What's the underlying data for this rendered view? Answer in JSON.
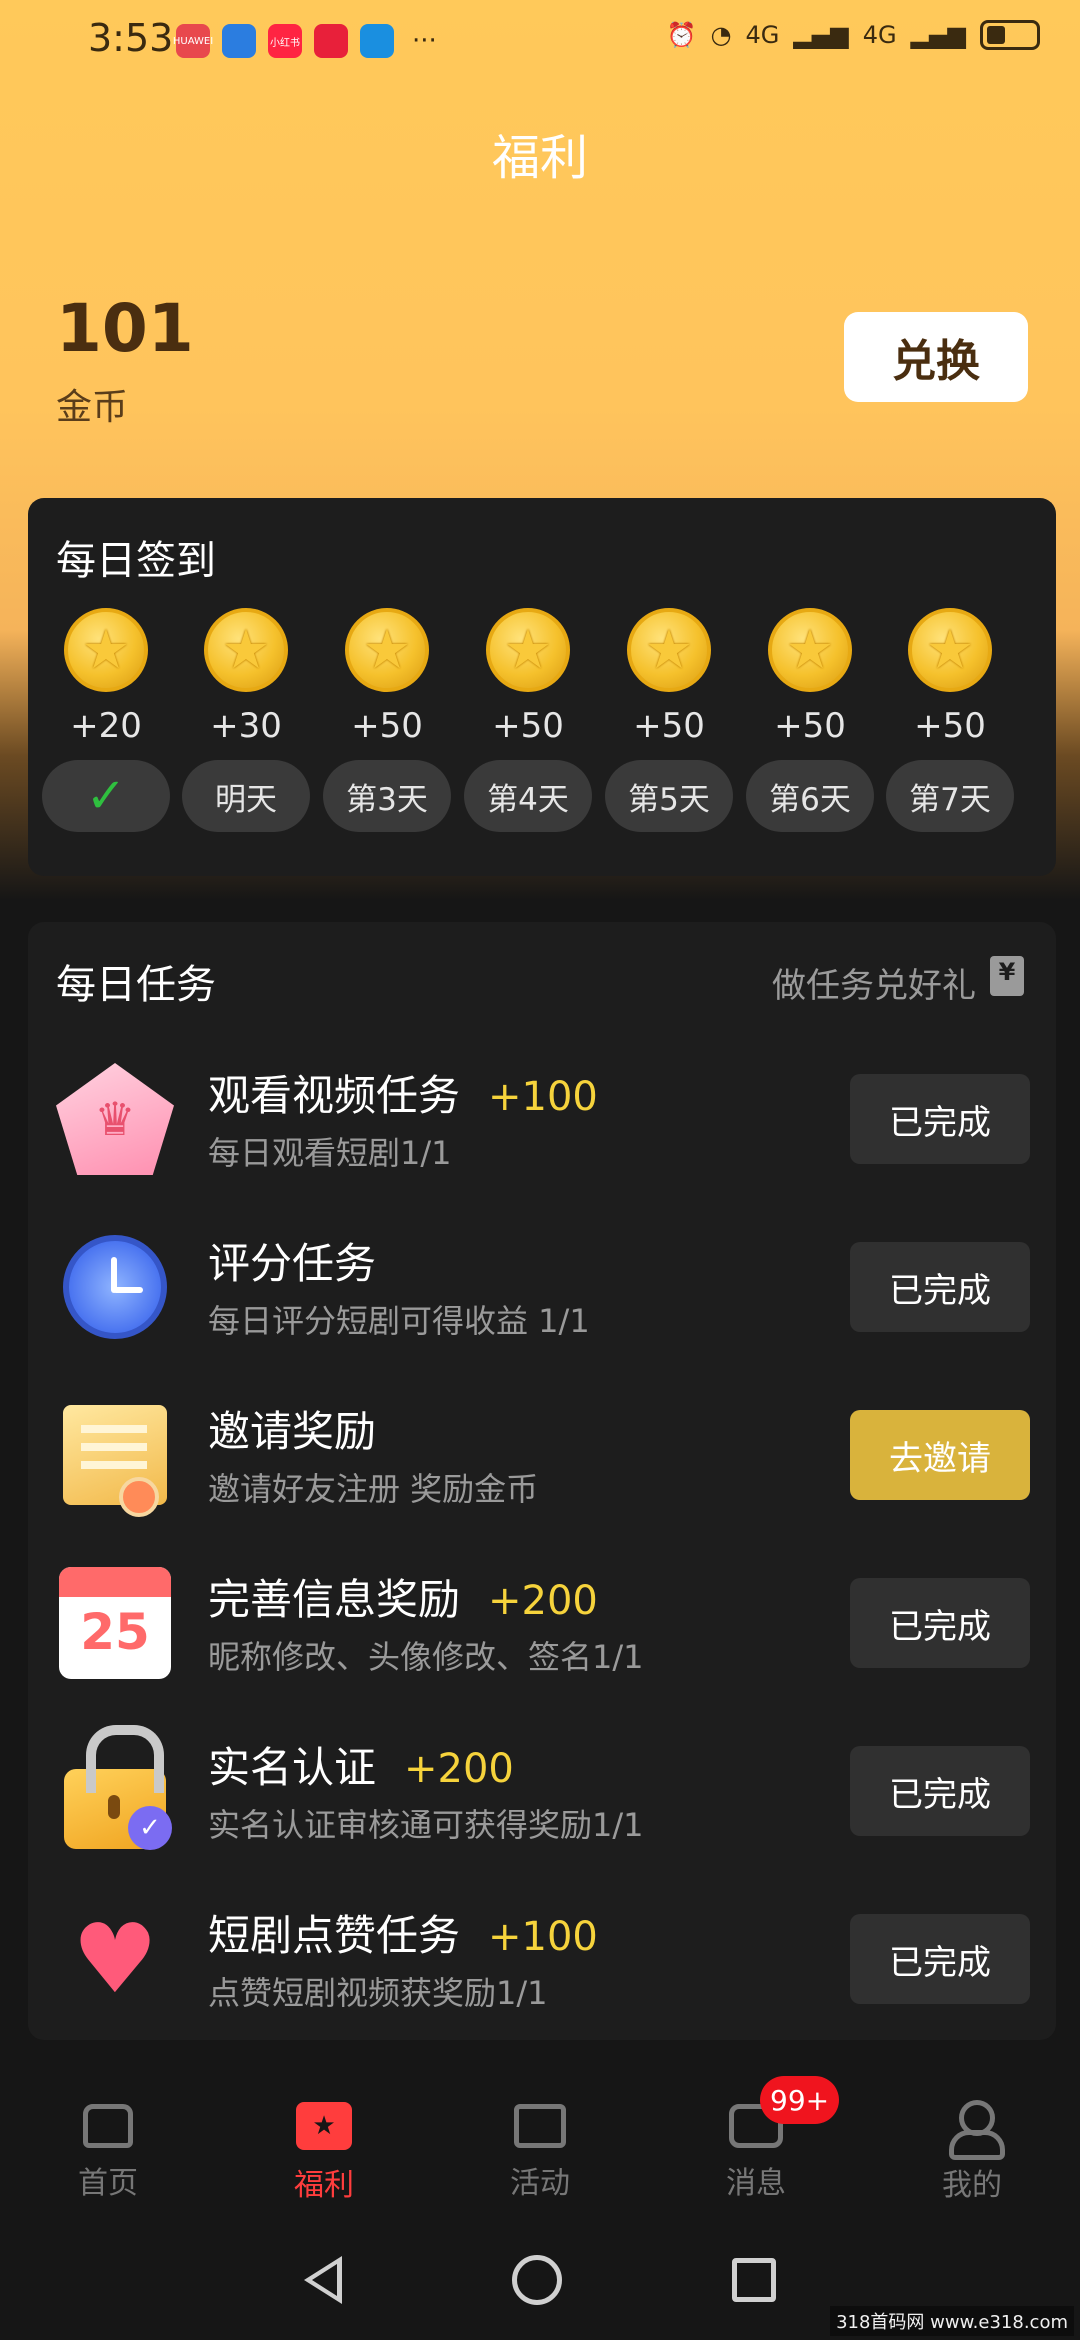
{
  "status_bar": {
    "time": "3:53",
    "apps": [
      {
        "label": "HUAWEI",
        "color": "#e8484d"
      },
      {
        "label": "",
        "color": "#2b7de0"
      },
      {
        "label": "小红书",
        "color": "#ff2442"
      },
      {
        "label": "",
        "color": "#e8203a"
      },
      {
        "label": "",
        "color": "#1a8fe0"
      }
    ],
    "more": "···",
    "network_1": "4G",
    "network_2": "4G"
  },
  "page_title": "福利",
  "coins": {
    "value": "101",
    "label": "金币",
    "exchange_label": "兑换"
  },
  "signin": {
    "title": "每日签到",
    "days": [
      {
        "reward": "+20",
        "label": "",
        "checked": true
      },
      {
        "reward": "+30",
        "label": "明天"
      },
      {
        "reward": "+50",
        "label": "第3天"
      },
      {
        "reward": "+50",
        "label": "第4天"
      },
      {
        "reward": "+50",
        "label": "第5天"
      },
      {
        "reward": "+50",
        "label": "第6天"
      },
      {
        "reward": "+50",
        "label": "第7天"
      }
    ],
    "check_mark": "✓"
  },
  "tasks": {
    "title": "每日任务",
    "link": "做任务兑好礼",
    "items": [
      {
        "name": "观看视频任务",
        "bonus": "+100",
        "desc": "每日观看短剧1/1",
        "button": "已完成",
        "icon": "crown-icon"
      },
      {
        "name": "评分任务",
        "bonus": "",
        "desc": "每日评分短剧可得收益 1/1",
        "button": "已完成",
        "icon": "alarm-clock-icon"
      },
      {
        "name": "邀请奖励",
        "bonus": "",
        "desc": "邀请好友注册 奖励金币",
        "button": "去邀请",
        "icon": "certificate-icon"
      },
      {
        "name": "完善信息奖励",
        "bonus": "+200",
        "desc": "昵称修改、头像修改、签名1/1",
        "button": "已完成",
        "icon": "calendar-icon"
      },
      {
        "name": "实名认证",
        "bonus": "+200",
        "desc": "实名认证审核通可获得奖励1/1",
        "button": "已完成",
        "icon": "lock-icon"
      },
      {
        "name": "短剧点赞任务",
        "bonus": "+100",
        "desc": "点赞短剧视频获奖励1/1",
        "button": "已完成",
        "icon": "heart-hand-icon"
      }
    ],
    "calendar_number": "25"
  },
  "nav": {
    "items": [
      {
        "label": "首页",
        "icon": "home-icon"
      },
      {
        "label": "福利",
        "icon": "ticket-icon",
        "active": true
      },
      {
        "label": "活动",
        "icon": "gift-icon"
      },
      {
        "label": "消息",
        "icon": "message-icon",
        "badge": "99+"
      },
      {
        "label": "我的",
        "icon": "user-icon"
      }
    ]
  },
  "watermark": "318首码网 www.e318.com",
  "colors": {
    "accent": "#ff3d3d",
    "gold": "#f6d33c",
    "invite_button": "#d9b33c"
  }
}
